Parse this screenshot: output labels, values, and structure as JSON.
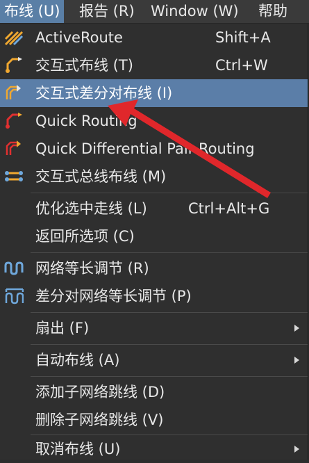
{
  "menubar": {
    "items": [
      "布线 (U)",
      "报告 (R)",
      "Window (W)",
      "帮助"
    ]
  },
  "menu": {
    "items": [
      {
        "label": "ActiveRoute",
        "shortcut": "Shift+A",
        "icon": "active-route-icon"
      },
      {
        "label": "交互式布线 (T)",
        "shortcut": "Ctrl+W",
        "icon": "interactive-route-icon"
      },
      {
        "label": "交互式差分对布线 (I)",
        "icon": "diff-pair-route-icon"
      },
      {
        "label": "Quick Routing",
        "icon": "quick-route-icon"
      },
      {
        "label": "Quick Differential Pair Routing",
        "icon": "quick-diff-route-icon"
      },
      {
        "label": "交互式总线布线 (M)",
        "icon": "bus-route-icon"
      },
      {
        "label": "优化选中走线 (L)",
        "shortcut": "Ctrl+Alt+G"
      },
      {
        "label": "返回所选项 (C)"
      },
      {
        "label": "网络等长调节 (R)",
        "icon": "length-tune-icon"
      },
      {
        "label": "差分对网络等长调节 (P)",
        "icon": "diff-length-tune-icon"
      },
      {
        "label": "扇出 (F)",
        "submenu": true
      },
      {
        "label": "自动布线 (A)",
        "submenu": true
      },
      {
        "label": "添加子网络跳线 (D)"
      },
      {
        "label": "删除子网络跳线 (V)"
      },
      {
        "label": "取消布线 (U)",
        "submenu": true
      }
    ]
  },
  "colors": {
    "highlight": "#5b7ea8",
    "annotation_arrow": "#e0272b",
    "icon_orange": "#f0a830",
    "icon_red": "#e03030",
    "icon_blue": "#6fa8dc"
  }
}
